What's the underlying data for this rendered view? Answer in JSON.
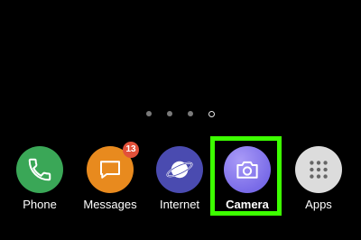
{
  "home_screen": {
    "page_indicator": {
      "pages": 4,
      "active_page": 4
    }
  },
  "dock": {
    "apps": [
      {
        "label": "Phone",
        "icon": "phone-icon",
        "color": "#3aa757"
      },
      {
        "label": "Messages",
        "icon": "message-bubble-icon",
        "color": "#e88a1e",
        "badge": "13",
        "badge_color": "#e2513a"
      },
      {
        "label": "Internet",
        "icon": "planet-icon",
        "color": "#4a4bb0"
      },
      {
        "label": "Camera",
        "icon": "camera-icon",
        "color": "#8c7ef0"
      },
      {
        "label": "Apps",
        "icon": "grid-dots-icon",
        "color": "#dcdcdc"
      }
    ]
  },
  "highlight_color": "#3cff00"
}
